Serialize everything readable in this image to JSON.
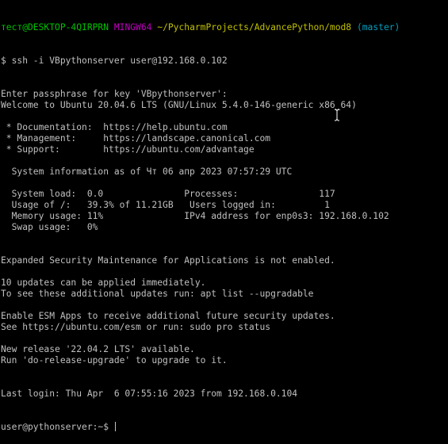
{
  "prompt": {
    "user_host": "тест@DESKTOP-4QIRPRN",
    "mingw": "MINGW64",
    "path": "~/PycharmProjects/AdvancePython/mod8",
    "branch": "(master)",
    "command": "$ ssh -i VBpythonserver user@192.168.0.102"
  },
  "lines": [
    "Enter passphrase for key 'VBpythonserver':",
    "Welcome to Ubuntu 20.04.6 LTS (GNU/Linux 5.4.0-146-generic x86_64)",
    "",
    " * Documentation:  https://help.ubuntu.com",
    " * Management:     https://landscape.canonical.com",
    " * Support:        https://ubuntu.com/advantage",
    "",
    "  System information as of Чт 06 апр 2023 07:57:29 UTC",
    "",
    "  System load:  0.0               Processes:               117",
    "  Usage of /:   39.3% of 11.21GB   Users logged in:         1",
    "  Memory usage: 11%               IPv4 address for enp0s3: 192.168.0.102",
    "  Swap usage:   0%",
    "",
    "",
    "Expanded Security Maintenance for Applications is not enabled.",
    "",
    "10 updates can be applied immediately.",
    "To see these additional updates run: apt list --upgradable",
    "",
    "Enable ESM Apps to receive additional future security updates.",
    "See https://ubuntu.com/esm or run: sudo pro status",
    "",
    "New release '22.04.2 LTS' available.",
    "Run 'do-release-upgrade' to upgrade to it.",
    "",
    "",
    "Last login: Thu Apr  6 07:55:16 2023 from 192.168.0.104"
  ],
  "final_prompt": "user@pythonserver:~$ ",
  "colors": {
    "background": "#000000",
    "text": "#c0c0c0",
    "user_host": "#00c000",
    "mingw": "#c000c0",
    "path": "#c0c000",
    "branch": "#00a0c0"
  },
  "icons": {
    "mouse_cursor": "i-beam-cursor-icon"
  }
}
